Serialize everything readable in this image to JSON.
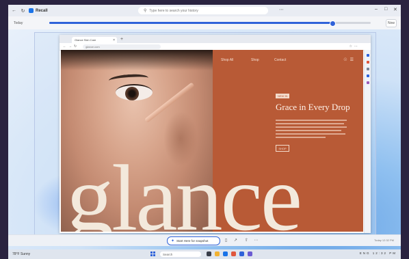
{
  "app": {
    "title": "Recall",
    "search_placeholder": "Type here to search your history"
  },
  "timeline": {
    "label": "Today",
    "position": 0.88,
    "now_label": "Now"
  },
  "browser": {
    "tab_title": "Glance Skin Care",
    "url": "glance.com",
    "site": {
      "nav": [
        "Shop All",
        "Shop",
        "Contact"
      ],
      "badge": "NEW IN",
      "headline": "Grace in Every Drop",
      "cta": "SHOP",
      "wordmark": "glance"
    }
  },
  "bottombar": {
    "pill_label": "Start Here for snapshot",
    "meta": "Today 12:32 PM"
  },
  "taskbar": {
    "weather": "78°F Sunny",
    "search_label": "Search",
    "tray": "ENG  12:32 PM"
  },
  "colors": {
    "accent": "#2f62d9",
    "panel": "#b85a36",
    "wordmark": "#f3e9dc"
  }
}
